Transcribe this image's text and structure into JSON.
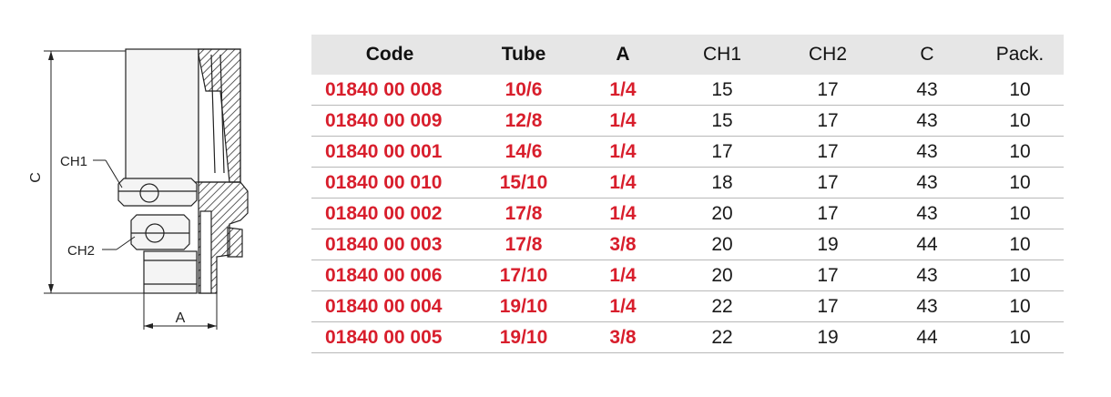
{
  "drawing": {
    "labels": {
      "c": "C",
      "ch1": "CH1",
      "ch2": "CH2",
      "a": "A"
    },
    "colors": {
      "line": "#222222",
      "hatch": "#333333",
      "body": "#f4f4f4"
    }
  },
  "table": {
    "colors": {
      "accent": "#d81e2c",
      "header_bg": "#e6e6e6",
      "rule": "#b8b8b8"
    },
    "headers": [
      "Code",
      "Tube",
      "A",
      "CH1",
      "CH2",
      "C",
      "Pack."
    ],
    "rows": [
      [
        "01840 00 008",
        "10/6",
        "1/4",
        "15",
        "17",
        "43",
        "10"
      ],
      [
        "01840 00 009",
        "12/8",
        "1/4",
        "15",
        "17",
        "43",
        "10"
      ],
      [
        "01840 00 001",
        "14/6",
        "1/4",
        "17",
        "17",
        "43",
        "10"
      ],
      [
        "01840 00 010",
        "15/10",
        "1/4",
        "18",
        "17",
        "43",
        "10"
      ],
      [
        "01840 00 002",
        "17/8",
        "1/4",
        "20",
        "17",
        "43",
        "10"
      ],
      [
        "01840 00 003",
        "17/8",
        "3/8",
        "20",
        "19",
        "44",
        "10"
      ],
      [
        "01840 00 006",
        "17/10",
        "1/4",
        "20",
        "17",
        "43",
        "10"
      ],
      [
        "01840 00 004",
        "19/10",
        "1/4",
        "22",
        "17",
        "43",
        "10"
      ],
      [
        "01840 00 005",
        "19/10",
        "3/8",
        "22",
        "19",
        "44",
        "10"
      ]
    ]
  }
}
